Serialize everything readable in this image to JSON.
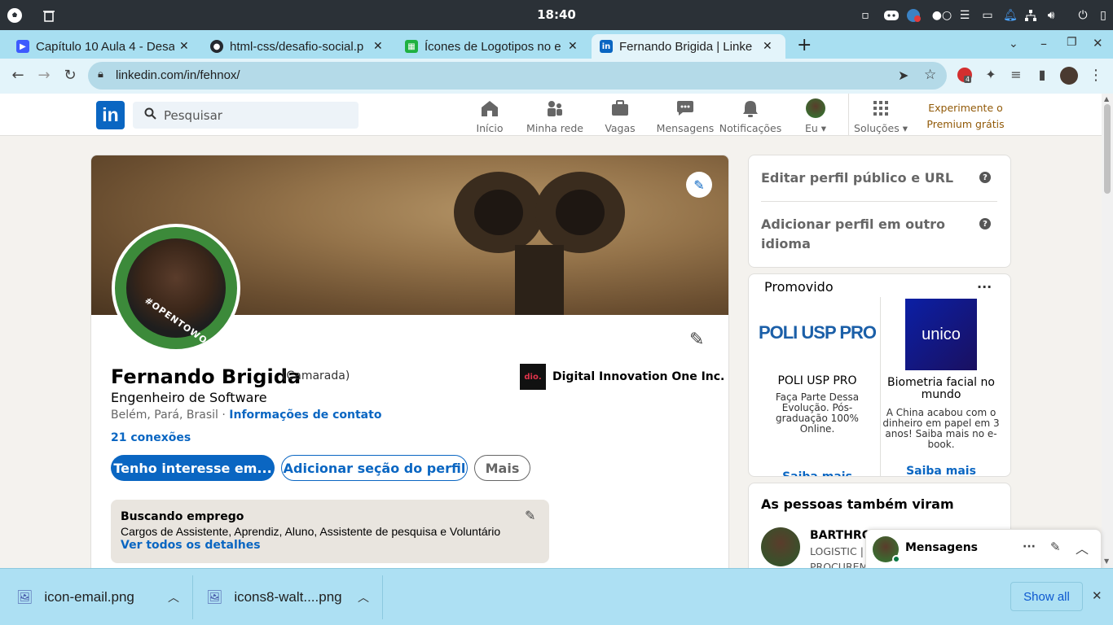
{
  "taskbar": {
    "clock": "18:40"
  },
  "browser": {
    "tabs": [
      {
        "title": "Capítulo 10 Aula 4 - Desa",
        "favicon": "youtube-icon"
      },
      {
        "title": "html-css/desafio-social.p",
        "favicon": "github-icon"
      },
      {
        "title": "Ícones de Logotipos no e",
        "favicon": "icons8-icon"
      },
      {
        "title": "Fernando Brigida | Linke",
        "favicon": "linkedin-icon",
        "active": true
      }
    ],
    "url": "linkedin.com/in/fehnox/",
    "extension_badge": "4"
  },
  "linkedin": {
    "logo": "in",
    "search_placeholder": "Pesquisar",
    "nav": [
      {
        "label": "Início",
        "icon": "home-icon"
      },
      {
        "label": "Minha rede",
        "icon": "network-icon"
      },
      {
        "label": "Vagas",
        "icon": "briefcase-icon"
      },
      {
        "label": "Mensagens",
        "icon": "chat-icon"
      },
      {
        "label": "Notificações",
        "icon": "bell-icon"
      },
      {
        "label": "Eu",
        "icon": "avatar-icon"
      },
      {
        "label": "Soluções",
        "icon": "grid-icon"
      }
    ],
    "premium_line1": "Experimente o",
    "premium_line2": "Premium grátis"
  },
  "profile": {
    "open_to_work_badge": "#OPENTOWORK",
    "name": "Fernando Brigida",
    "pronouns": "(Camarada)",
    "headline": "Engenheiro de Software",
    "location": "Belém, Pará, Brasil",
    "separator": "·",
    "contact_link": "Informações de contato",
    "connections": "21 conexões",
    "company": "Digital Innovation One Inc.",
    "company_logo_text": "dio.",
    "buttons": {
      "interest": "Tenho interesse em...",
      "add_section": "Adicionar seção do perfil",
      "more": "Mais"
    },
    "open_to_work": {
      "title": "Buscando emprego",
      "roles": "Cargos de Assistente, Aprendiz, Aluno, Assistente de pesquisa e Voluntário",
      "link": "Ver todos os detalhes"
    }
  },
  "rail": {
    "edit_public": "Editar perfil público e URL",
    "add_language_line1": "Adicionar perfil em outro",
    "add_language_line2": "idioma",
    "help": "?",
    "promo_title": "Promovido",
    "ads": [
      {
        "logo": "POLI USP PRO",
        "name": "POLI USP PRO",
        "desc": "Faça Parte Dessa Evolução. Pós-graduação 100% Online.",
        "cta": "Saiba mais"
      },
      {
        "logo": "unico",
        "name": "Biometria facial no mundo",
        "desc": "A China acabou com o dinheiro em papel em 3 anos! Saiba mais no e-book.",
        "cta": "Saiba mais"
      }
    ],
    "people_title": "As pessoas também viram",
    "person": {
      "name": "BARTHROI",
      "subtitle": "LOGISTIC | C",
      "subtitle2": "PROCUREME"
    }
  },
  "messaging": {
    "title": "Mensagens"
  },
  "downloads": {
    "items": [
      {
        "name": "icon-email.png"
      },
      {
        "name": "icons8-walt....png"
      }
    ],
    "show_all": "Show all"
  },
  "colors": {
    "linkedin_blue": "#0a66c2",
    "premium_gold": "#915907",
    "tab_strip": "#a8dff1",
    "open_to_work_green": "#3c8a3a"
  }
}
